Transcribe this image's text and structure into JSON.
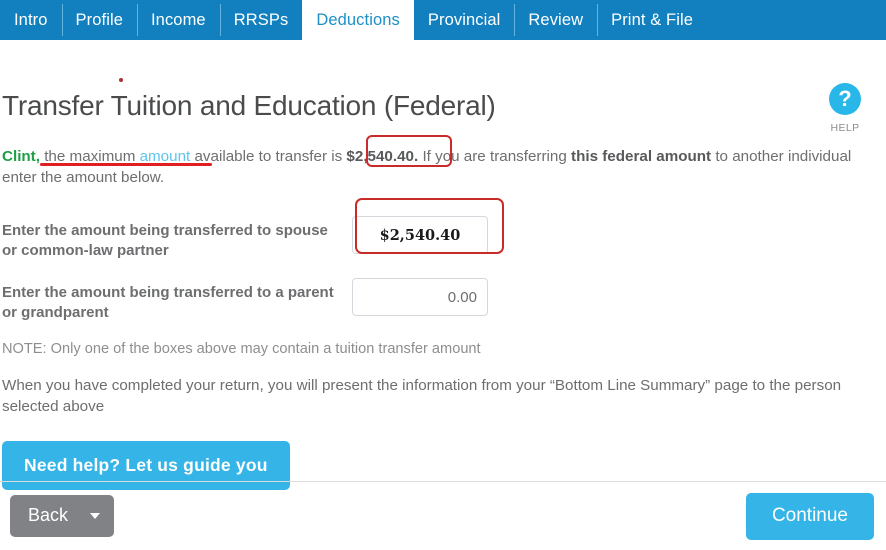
{
  "tabs": [
    {
      "label": "Intro",
      "active": false
    },
    {
      "label": "Profile",
      "active": false
    },
    {
      "label": "Income",
      "active": false
    },
    {
      "label": "RRSPs",
      "active": false
    },
    {
      "label": "Deductions",
      "active": true
    },
    {
      "label": "Provincial",
      "active": false
    },
    {
      "label": "Review",
      "active": false
    },
    {
      "label": "Print & File",
      "active": false
    }
  ],
  "help": {
    "icon": "question-mark-icon",
    "glyph": "?",
    "label": "HELP"
  },
  "page": {
    "title": "Transfer Tuition and Education (Federal)"
  },
  "intro": {
    "name": "Clint",
    "comma": ",",
    "text_before_link": " the maximum ",
    "link_text": "amount",
    "text_after_link": " available to transfer is ",
    "max_amount": "$2,540.40.",
    "text_mid": " If you are transferring ",
    "bold_phrase": "this federal amount",
    "text_end": " to another individual enter the amount below."
  },
  "fields": [
    {
      "label": "Enter the amount being transferred to spouse or common-law partner",
      "value": "$2,540.40",
      "placeholder": "",
      "name": "spouse-transfer-amount"
    },
    {
      "label": "Enter the amount being transferred to a parent or grandparent",
      "value": "0.00",
      "placeholder": "",
      "name": "parent-transfer-amount"
    }
  ],
  "note": "NOTE: Only one of the boxes above may contain a tuition transfer amount",
  "summary_text": "When you have completed your return, you will present the information from your “Bottom Line Summary” page to the person selected above",
  "guide_button": "Need help? Let us guide you",
  "footer": {
    "back_label": "Back",
    "continue_label": "Continue"
  },
  "colors": {
    "tab_bar_blue": "#1280bf",
    "active_tab_text": "#1e90c8",
    "accent_button": "#35b4e8",
    "help_circle": "#29b6e8",
    "name_green": "#1e9e45",
    "link_blue": "#5ec4ee",
    "back_gray": "#808285",
    "annotation_red": "#c92a2a"
  }
}
